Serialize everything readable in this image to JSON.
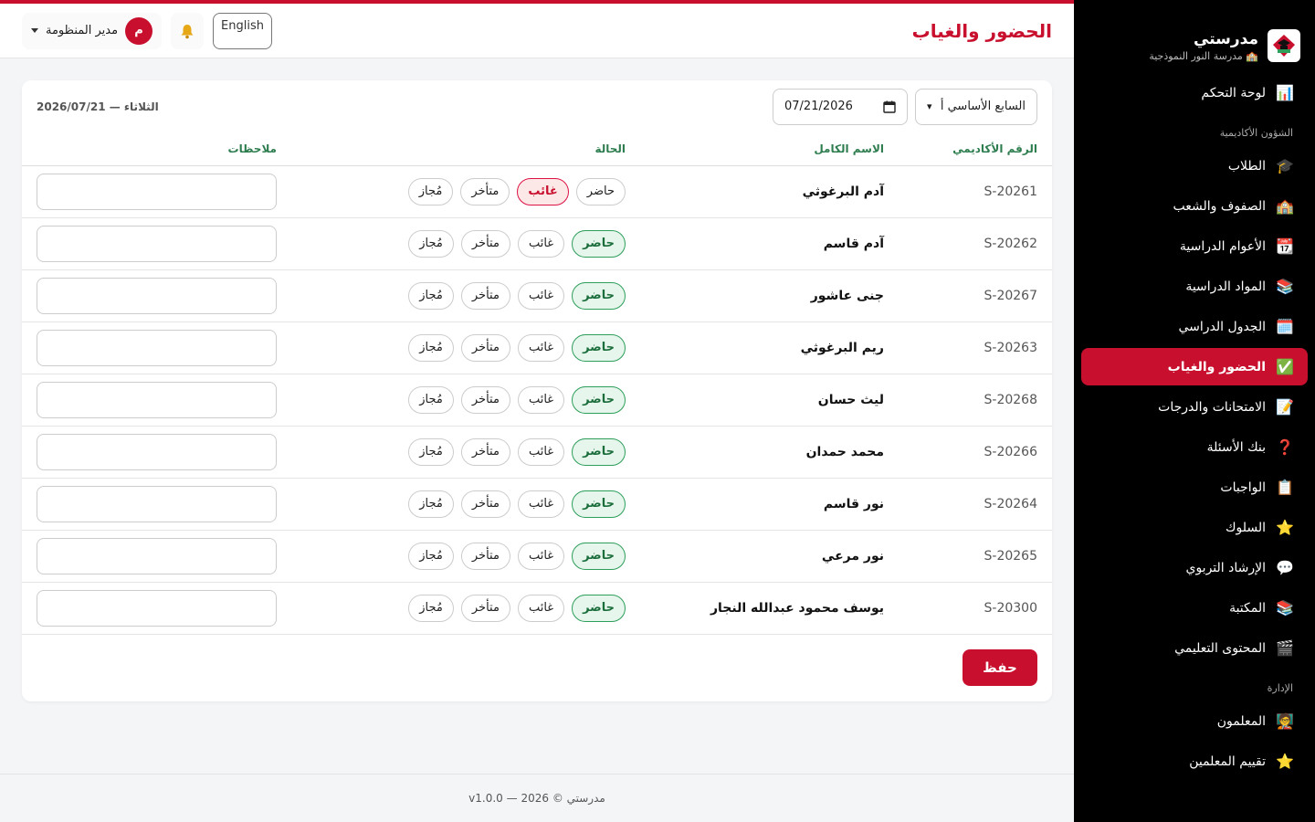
{
  "brand": {
    "name": "مدرستي",
    "school": "🏫 مدرسة النور النموذجية"
  },
  "sidebar": {
    "top": [
      {
        "label": "لوحة التحكم",
        "icon": "📊"
      }
    ],
    "sections": [
      {
        "title": "الشؤون الأكاديمية",
        "items": [
          {
            "label": "الطلاب",
            "icon": "🎓"
          },
          {
            "label": "الصفوف والشعب",
            "icon": "🏫"
          },
          {
            "label": "الأعوام الدراسية",
            "icon": "📆"
          },
          {
            "label": "المواد الدراسية",
            "icon": "📚"
          },
          {
            "label": "الجدول الدراسي",
            "icon": "🗓️"
          },
          {
            "label": "الحضور والغياب",
            "icon": "✅",
            "active": true
          },
          {
            "label": "الامتحانات والدرجات",
            "icon": "📝"
          },
          {
            "label": "بنك الأسئلة",
            "icon": "❓"
          },
          {
            "label": "الواجبات",
            "icon": "📋"
          },
          {
            "label": "السلوك",
            "icon": "⭐"
          },
          {
            "label": "الإرشاد التربوي",
            "icon": "💬"
          },
          {
            "label": "المكتبة",
            "icon": "📚"
          },
          {
            "label": "المحتوى التعليمي",
            "icon": "🎬"
          }
        ]
      },
      {
        "title": "الإدارة",
        "items": [
          {
            "label": "المعلمون",
            "icon": "🧑‍🏫"
          },
          {
            "label": "تقييم المعلمين",
            "icon": "⭐"
          }
        ]
      }
    ]
  },
  "header": {
    "title": "الحضور والغياب",
    "lang_label": "English",
    "user_name": "مدير المنظومة",
    "user_initial": "م"
  },
  "filters": {
    "class_value": "السابع الأساسي أ",
    "date_value": "07/21/2026",
    "date_display": "الثلاثاء — 2026/07/21"
  },
  "table": {
    "columns": [
      "الرقم الأكاديمي",
      "الاسم الكامل",
      "الحالة",
      "ملاحظات"
    ],
    "status_options": [
      "حاضر",
      "غائب",
      "متأخر",
      "مُجاز"
    ],
    "rows": [
      {
        "id": "S-20261",
        "name": "آدم البرغوثي",
        "status": "غائب"
      },
      {
        "id": "S-20262",
        "name": "آدم قاسم",
        "status": "حاضر"
      },
      {
        "id": "S-20267",
        "name": "جنى عاشور",
        "status": "حاضر"
      },
      {
        "id": "S-20263",
        "name": "ريم البرغوثي",
        "status": "حاضر"
      },
      {
        "id": "S-20268",
        "name": "ليث حسان",
        "status": "حاضر"
      },
      {
        "id": "S-20266",
        "name": "محمد حمدان",
        "status": "حاضر"
      },
      {
        "id": "S-20264",
        "name": "نور قاسم",
        "status": "حاضر"
      },
      {
        "id": "S-20265",
        "name": "نور مرعي",
        "status": "حاضر"
      },
      {
        "id": "S-20300",
        "name": "يوسف محمود عبدالله النجار",
        "status": "حاضر"
      }
    ]
  },
  "actions": {
    "save_label": "حفظ"
  },
  "footer": {
    "text": "مدرستي © 2026 — v1.0.0"
  },
  "colors": {
    "accent": "#c8102e",
    "present": "#2e9e5b",
    "header_green": "#2e7d4f"
  }
}
